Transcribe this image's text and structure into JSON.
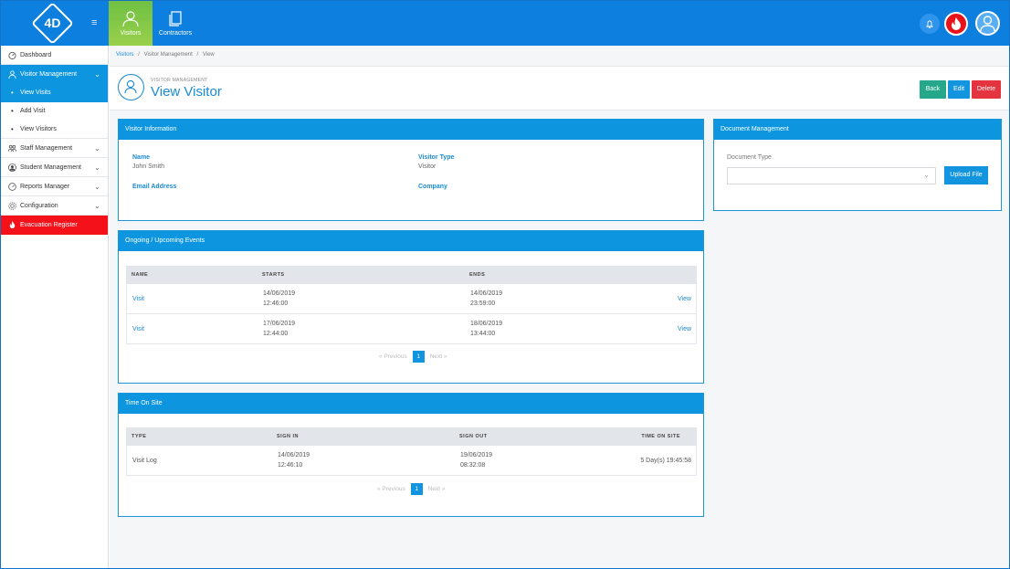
{
  "topnav": {
    "logo_text": "4D",
    "tabs": [
      {
        "label": "Visitors",
        "icon": "person-icon",
        "active": true
      },
      {
        "label": "Contractors",
        "icon": "documents-icon",
        "active": false
      }
    ]
  },
  "sidebar": {
    "items": [
      {
        "label": "Dashboard",
        "icon": "dashboard-icon"
      },
      {
        "label": "Visitor Management",
        "icon": "person-icon"
      },
      {
        "label": "View Visits"
      },
      {
        "label": "Add Visit"
      },
      {
        "label": "View Visitors"
      },
      {
        "label": "Staff Management",
        "icon": "group-icon"
      },
      {
        "label": "Student Management",
        "icon": "student-icon"
      },
      {
        "label": "Reports Manager",
        "icon": "gauge-icon"
      },
      {
        "label": "Configuration",
        "icon": "gear-icon"
      },
      {
        "label": "Evacuation Register",
        "icon": "fire-icon"
      }
    ]
  },
  "breadcrumb": {
    "link": "Visitors",
    "sep": "/",
    "middle": "Visitor Management",
    "current": "View"
  },
  "page": {
    "section_label": "VISITOR MANAGEMENT",
    "title": "View Visitor"
  },
  "actions": {
    "back": "Back",
    "edit": "Edit",
    "delete": "Delete"
  },
  "visitor_info": {
    "title": "Visitor Information",
    "name_label": "Name",
    "name_value": "John Smith",
    "type_label": "Visitor Type",
    "type_value": "Visitor",
    "email_label": "Email Address",
    "company_label": "Company"
  },
  "document_mgmt": {
    "title": "Document Management",
    "type_label": "Document Type",
    "upload_label": "Upload File"
  },
  "events": {
    "title": "Ongoing / Upcoming Events",
    "columns": [
      "NAME",
      "STARTS",
      "ENDS"
    ],
    "rows": [
      {
        "name": "Visit",
        "start_date": "14/06/2019",
        "start_time": "12:46:00",
        "end_date": "14/06/2019",
        "end_time": "23:59:00",
        "action": "View"
      },
      {
        "name": "Visit",
        "start_date": "17/06/2019",
        "start_time": "12:44:00",
        "end_date": "18/06/2019",
        "end_time": "13:44:00",
        "action": "View"
      }
    ],
    "pager": {
      "prev": "« Previous",
      "page": "1",
      "next": "Next »"
    }
  },
  "time_on_site": {
    "title": "Time On Site",
    "columns": [
      "TYPE",
      "SIGN IN",
      "SIGN OUT",
      "TIME ON SITE"
    ],
    "rows": [
      {
        "type": "Visit Log",
        "in_date": "14/06/2019",
        "in_time": "12:46:10",
        "out_date": "19/06/2019",
        "out_time": "08:32:08",
        "duration": "5 Day(s) 19:45:58"
      }
    ],
    "pager": {
      "prev": "« Previous",
      "page": "1",
      "next": "Next »"
    }
  },
  "colors": {
    "primary": "#0d96df",
    "topbar": "#0d7fde",
    "active_tab": "#8cc63f",
    "danger": "#f4111a",
    "back": "#24a78a",
    "delete": "#e3343f"
  }
}
